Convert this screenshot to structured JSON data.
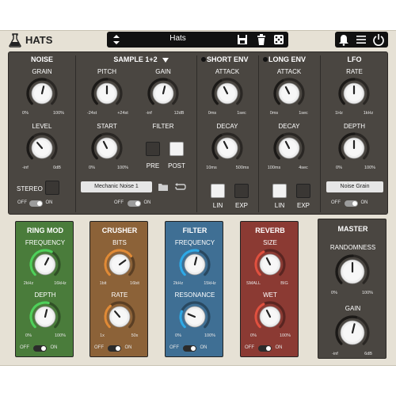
{
  "app_title": "HATS",
  "preset": {
    "name": "Hats"
  },
  "noise": {
    "title": "NOISE",
    "grain": {
      "label": "GRAIN",
      "min": "0%",
      "max": "100%"
    },
    "level": {
      "label": "LEVEL",
      "min": "-inf",
      "max": "0dB"
    },
    "stereo": {
      "label": "STEREO"
    },
    "toggle": {
      "off": "OFF",
      "on": "ON"
    }
  },
  "sample": {
    "title": "SAMPLE 1+2",
    "pitch": {
      "label": "PITCH",
      "min": "-24st",
      "max": "+24st"
    },
    "gain": {
      "label": "GAIN",
      "min": "-inf",
      "max": "12dB"
    },
    "start": {
      "label": "START",
      "min": "0%",
      "max": "100%"
    },
    "filter": {
      "label": "FILTER",
      "pre": "PRE",
      "post": "POST"
    },
    "sample_name": "Mechanic Noise 1",
    "toggle": {
      "off": "OFF",
      "on": "ON"
    }
  },
  "short_env": {
    "title": "SHORT ENV",
    "attack": {
      "label": "ATTACK",
      "min": "0ms",
      "max": "1sec"
    },
    "decay": {
      "label": "DECAY",
      "min": "10ms",
      "max": "500ms"
    },
    "lin": "LIN",
    "exp": "EXP"
  },
  "long_env": {
    "title": "LONG ENV",
    "attack": {
      "label": "ATTACK",
      "min": "0ms",
      "max": "1sec"
    },
    "decay": {
      "label": "DECAY",
      "min": "100ms",
      "max": "4sec"
    },
    "lin": "LIN",
    "exp": "EXP"
  },
  "lfo": {
    "title": "LFO",
    "rate": {
      "label": "RATE",
      "min": "1Hz",
      "max": "1kHz"
    },
    "depth": {
      "label": "DEPTH",
      "min": "0%",
      "max": "100%"
    },
    "target": "Noise Grain",
    "toggle": {
      "off": "OFF",
      "on": "ON"
    }
  },
  "ringmod": {
    "title": "RING MOD",
    "frequency": {
      "label": "FREQUENCY",
      "min": "2kHz",
      "max": "16kHz"
    },
    "depth": {
      "label": "DEPTH",
      "min": "0%",
      "max": "100%"
    },
    "toggle": {
      "off": "OFF",
      "on": "ON"
    },
    "color": "#4a7c3b"
  },
  "crusher": {
    "title": "CRUSHER",
    "bits": {
      "label": "BITS",
      "min": "1bit",
      "max": "16bit"
    },
    "rate": {
      "label": "RATE",
      "min": "1x",
      "max": "50x"
    },
    "toggle": {
      "off": "OFF",
      "on": "ON"
    },
    "color": "#8c6238"
  },
  "filter": {
    "title": "FILTER",
    "frequency": {
      "label": "FREQUENCY",
      "min": "2kHz",
      "max": "15kHz"
    },
    "resonance": {
      "label": "RESONANCE",
      "min": "0%",
      "max": "100%"
    },
    "toggle": {
      "off": "OFF",
      "on": "ON"
    },
    "color": "#3f6f94"
  },
  "reverb": {
    "title": "REVERB",
    "size": {
      "label": "SIZE",
      "min": "SMALL",
      "max": "BIG"
    },
    "wet": {
      "label": "WET",
      "min": "0%",
      "max": "100%"
    },
    "toggle": {
      "off": "OFF",
      "on": "ON"
    },
    "color": "#8b3a33"
  },
  "master": {
    "title": "MASTER",
    "randomness": {
      "label": "RANDOMNESS",
      "min": "0%",
      "max": "100%"
    },
    "gain": {
      "label": "GAIN",
      "min": "-inf",
      "max": "6dB"
    }
  }
}
